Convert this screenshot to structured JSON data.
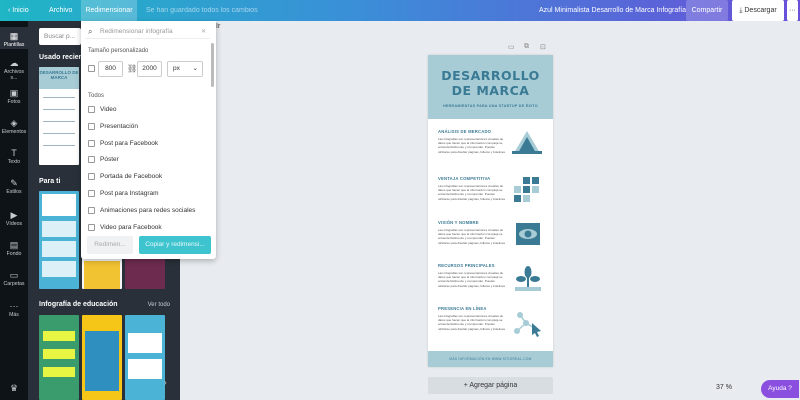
{
  "topbar": {
    "home": "Inicio",
    "file": "Archivo",
    "resize": "Redimensionar",
    "saved": "Se han guardado todos los cambios",
    "doc_title": "Azul Minimalista Desarrollo de Marca Infografía",
    "share": "Compartir",
    "download": "Descargar",
    "more": "···",
    "download_icon": "download-icon"
  },
  "rail": [
    {
      "label": "Plantillas",
      "icon": "▦"
    },
    {
      "label": "Archivos s...",
      "icon": "☁"
    },
    {
      "label": "Fotos",
      "icon": "▣"
    },
    {
      "label": "Elementos",
      "icon": "◈"
    },
    {
      "label": "Texto",
      "icon": "T"
    },
    {
      "label": "Estilos",
      "icon": "✎"
    },
    {
      "label": "Vídeos",
      "icon": "▶"
    },
    {
      "label": "Fondo",
      "icon": "▤"
    },
    {
      "label": "Carpetas",
      "icon": "▭"
    },
    {
      "label": "Más",
      "icon": "···"
    }
  ],
  "panel": {
    "search_placeholder": "Buscar p...",
    "recent_title": "Usado reciente",
    "foryou_title": "Para ti",
    "education_title": "Infografía de educación",
    "see_all": "Ver todo",
    "recent_thumb_title": "DESARROLLO DE MARCA"
  },
  "dropdown": {
    "search_placeholder": "Redimensionar infografía",
    "custom_size": "Tamaño personalizado",
    "width": "800",
    "height": "2000",
    "unit": "px",
    "all": "Todos",
    "options": [
      "Video",
      "Presentación",
      "Post para Facebook",
      "Póster",
      "Portada de Facebook",
      "Post para Instagram",
      "Animaciones para redes sociales",
      "Video para Facebook"
    ],
    "resize_btn": "Redimen...",
    "copy_btn": "Copiar y redimensi..."
  },
  "canvas": {
    "toolbar_left": "Ir",
    "title_line1": "DESARROLLO",
    "title_line2": "DE MARCA",
    "subtitle": "HERRAMIENTAS PARA UNA STARTUP DE ÉXITO",
    "sections": [
      {
        "heading": "ANÁLISIS DE MERCADO",
        "icon": "mountain-icon"
      },
      {
        "heading": "VENTAJA COMPETITIVA",
        "icon": "grid-icon"
      },
      {
        "heading": "VISIÓN Y NOMBRE",
        "icon": "eye-icon"
      },
      {
        "heading": "RECURSOS PRINCIPALES",
        "icon": "plant-icon"
      },
      {
        "heading": "PRESENCIA EN LÍNEA",
        "icon": "network-icon"
      }
    ],
    "body_text": "Las infografías son representaciones visuales de datos que hacen que la información compleja se entienda fácilmente y comprender. Pueden utilizarse para diseñar páginas, folletos y boletines",
    "footer": "MÁS INFORMACIÓN EN WWW.SITIOREAL.COM",
    "add_page": "+ Agregar página",
    "zoom": "37 %",
    "help": "Ayuda ?",
    "accent": "#3a7a95",
    "light": "#a7ccd6"
  }
}
